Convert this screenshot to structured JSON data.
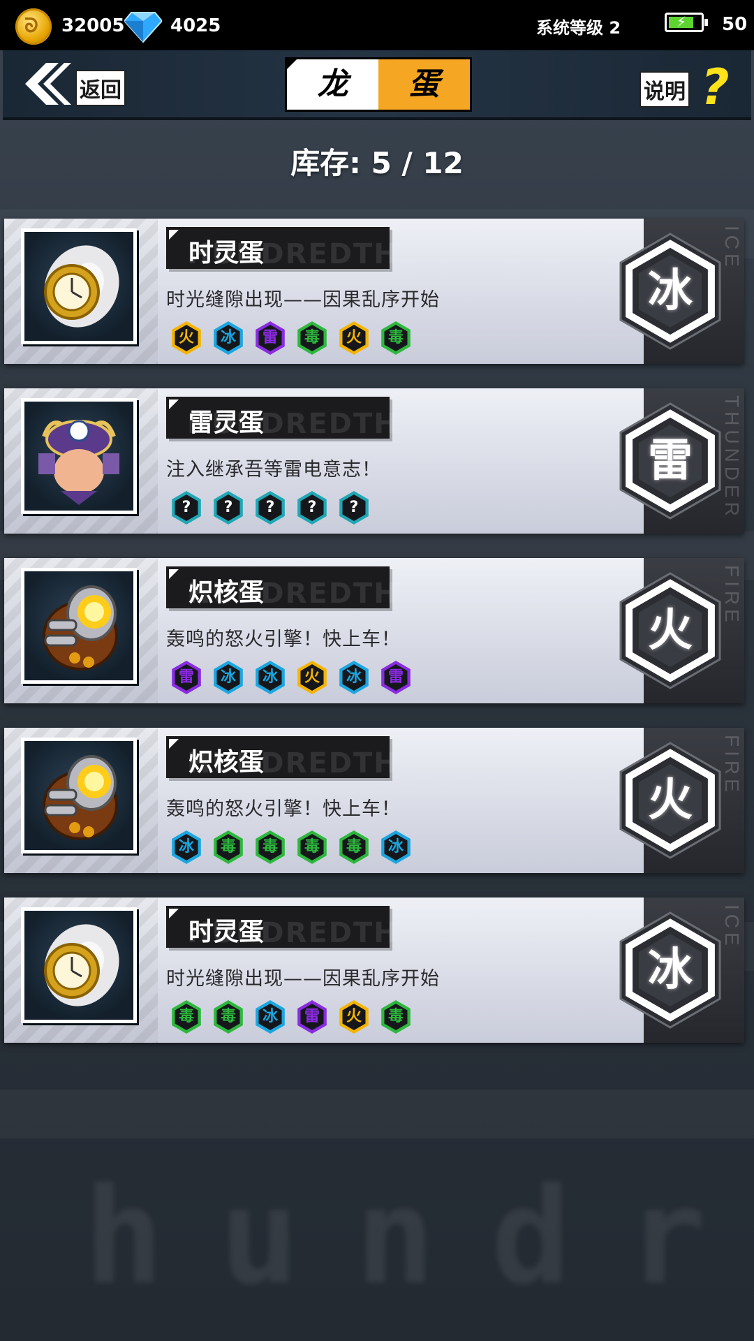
{
  "status": {
    "coins": "32005",
    "gems": "4025",
    "system_level": "系统等级 2",
    "battery": "50"
  },
  "header": {
    "back_label": "返回",
    "title_left": "龙",
    "title_right": "蛋",
    "help_label": "说明",
    "help_mark": "?"
  },
  "inventory": {
    "label": "库存: 5 / 12"
  },
  "background_text": "hundr",
  "name_watermark": "HUNDREDTH",
  "element_colors": {
    "火": "#f5b400",
    "冰": "#1aa6e0",
    "雷": "#8a2be2",
    "毒": "#2db83d",
    "?": "#1fa7b5"
  },
  "eggs": [
    {
      "name": "时灵蛋",
      "description": "时光缝隙出现——因果乱序开始",
      "image": "clock-egg-icon",
      "type": "冰",
      "type_label": "ICE",
      "elements": [
        "火",
        "冰",
        "雷",
        "毒",
        "火",
        "毒"
      ]
    },
    {
      "name": "雷灵蛋",
      "description": "注入继承吾等雷电意志！",
      "image": "samurai-egg-icon",
      "type": "雷",
      "type_label": "THUNDER",
      "elements": [
        "?",
        "?",
        "?",
        "?",
        "?"
      ]
    },
    {
      "name": "炽核蛋",
      "description": "轰鸣的怒火引擎！快上车！",
      "image": "engine-egg-icon",
      "type": "火",
      "type_label": "FIRE",
      "elements": [
        "雷",
        "冰",
        "冰",
        "火",
        "冰",
        "雷"
      ]
    },
    {
      "name": "炽核蛋",
      "description": "轰鸣的怒火引擎！快上车！",
      "image": "engine-egg-icon",
      "type": "火",
      "type_label": "FIRE",
      "elements": [
        "冰",
        "毒",
        "毒",
        "毒",
        "毒",
        "冰"
      ]
    },
    {
      "name": "时灵蛋",
      "description": "时光缝隙出现——因果乱序开始",
      "image": "clock-egg-icon",
      "type": "冰",
      "type_label": "ICE",
      "elements": [
        "毒",
        "毒",
        "冰",
        "雷",
        "火",
        "毒"
      ]
    }
  ]
}
